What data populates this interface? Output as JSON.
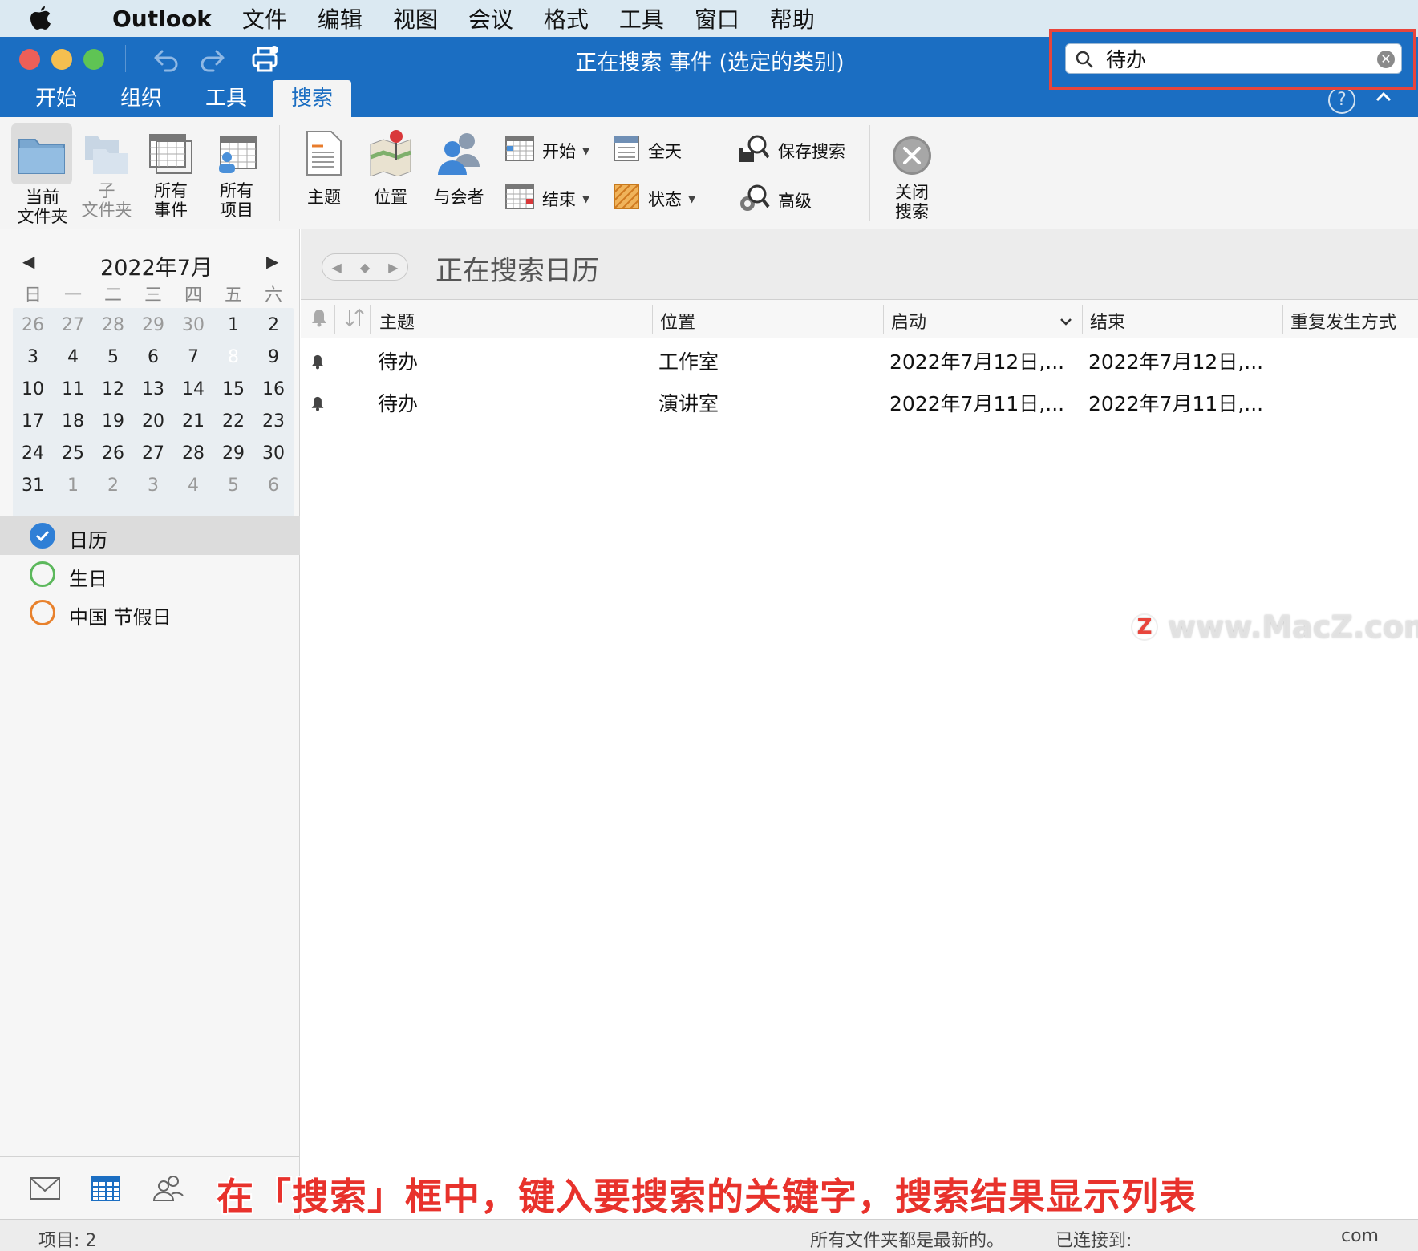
{
  "menubar": {
    "app": "Outlook",
    "items": [
      "文件",
      "编辑",
      "视图",
      "会议",
      "格式",
      "工具",
      "窗口",
      "帮助"
    ]
  },
  "window": {
    "title": "正在搜索 事件 (选定的类别)"
  },
  "search": {
    "value": "待办"
  },
  "tabs": [
    {
      "label": "开始"
    },
    {
      "label": "组织"
    },
    {
      "label": "工具"
    },
    {
      "label": "搜索"
    }
  ],
  "ribbon": {
    "current_folder": "当前\n文件夹",
    "current_folder_l1": "当前",
    "current_folder_l2": "文件夹",
    "subfolder_l1": "子",
    "subfolder_l2": "文件夹",
    "all_events_l1": "所有",
    "all_events_l2": "事件",
    "all_items_l1": "所有",
    "all_items_l2": "项目",
    "subject": "主题",
    "location": "位置",
    "attendees": "与会者",
    "start": "开始",
    "end": "结束",
    "all_day": "全天",
    "status": "状态",
    "save_search": "保存搜索",
    "advanced": "高级",
    "close_search_l1": "关闭",
    "close_search_l2": "搜索"
  },
  "calendar": {
    "month_title": "2022年7月",
    "weekdays": [
      "日",
      "一",
      "二",
      "三",
      "四",
      "五",
      "六"
    ],
    "weeks": [
      [
        "26",
        "27",
        "28",
        "29",
        "30",
        "1",
        "2"
      ],
      [
        "3",
        "4",
        "5",
        "6",
        "7",
        "8",
        "9"
      ],
      [
        "10",
        "11",
        "12",
        "13",
        "14",
        "15",
        "16"
      ],
      [
        "17",
        "18",
        "19",
        "20",
        "21",
        "22",
        "23"
      ],
      [
        "24",
        "25",
        "26",
        "27",
        "28",
        "29",
        "30"
      ],
      [
        "31",
        "1",
        "2",
        "3",
        "4",
        "5",
        "6"
      ]
    ],
    "today": "8"
  },
  "categories": [
    {
      "label": "日历",
      "color": "#2f7fd6",
      "checked": true
    },
    {
      "label": "生日",
      "color": "#5cb85c",
      "checked": false
    },
    {
      "label": "中国 节假日",
      "color": "#e8812c",
      "checked": false
    }
  ],
  "main": {
    "title": "正在搜索日历",
    "columns": {
      "subject": "主题",
      "location": "位置",
      "start": "启动",
      "end": "结束",
      "recurrence": "重复发生方式"
    },
    "rows": [
      {
        "subject": "待办",
        "location": "工作室",
        "start": "2022年7月12日,...",
        "end": "2022年7月12日,..."
      },
      {
        "subject": "待办",
        "location": "演讲室",
        "start": "2022年7月11日,...",
        "end": "2022年7月11日,..."
      }
    ]
  },
  "watermark": {
    "badge": "Z",
    "text": "www.MacZ.com"
  },
  "caption": "在「搜索」框中，键入要搜索的关键字，搜索结果显示列表",
  "statusbar": {
    "items": "项目: 2",
    "up_to_date": "所有文件夹都是最新的。",
    "connected": "已连接到:",
    "domain": "com"
  },
  "colors": {
    "brand_blue": "#1b6ec2",
    "highlight_red": "#e8453c",
    "today_blue": "#1668b8"
  }
}
